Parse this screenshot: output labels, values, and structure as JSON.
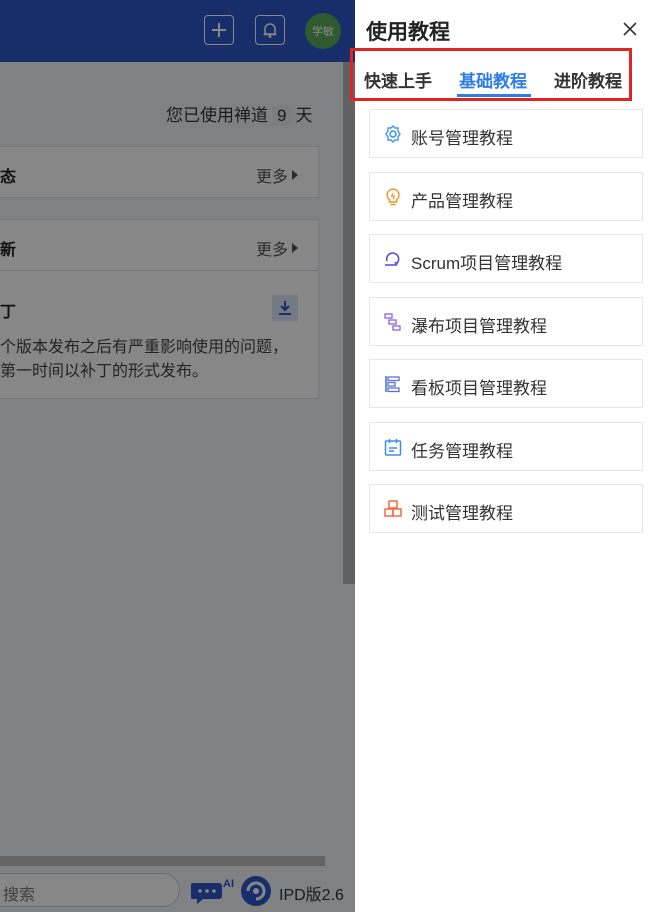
{
  "app": {
    "avatar_text": "学敏",
    "usage": {
      "prefix": "您已使用禅道",
      "days": "9",
      "suffix": "天"
    },
    "cards": {
      "dynamic": {
        "title": "态",
        "more": "更多"
      },
      "updates": {
        "title": "新",
        "more": "更多",
        "patch_title": "丁",
        "patch_lines": [
          "个版本发布之后有严重影响使用的问题，",
          "第一时间以补丁的形式发布。"
        ]
      }
    },
    "bottom": {
      "search_placeholder": "搜索",
      "ai_label": "AI",
      "version": "IPD版2.6"
    }
  },
  "drawer": {
    "title": "使用教程",
    "tabs": [
      {
        "label": "快速上手",
        "active": false
      },
      {
        "label": "基础教程",
        "active": true
      },
      {
        "label": "进阶教程",
        "active": false
      }
    ],
    "items": [
      {
        "label": "账号管理教程",
        "icon": "gear-icon",
        "color": "#3d9be9"
      },
      {
        "label": "产品管理教程",
        "icon": "lightbulb-icon",
        "color": "#f0922c"
      },
      {
        "label": "Scrum项目管理教程",
        "icon": "loop-icon",
        "color": "#5b4fd8"
      },
      {
        "label": "瀑布项目管理教程",
        "icon": "waterfall-icon",
        "color": "#8e6bf0"
      },
      {
        "label": "看板项目管理教程",
        "icon": "kanban-icon",
        "color": "#5b6fe0"
      },
      {
        "label": "任务管理教程",
        "icon": "calendar-icon",
        "color": "#3b8fe8"
      },
      {
        "label": "测试管理教程",
        "icon": "boxes-icon",
        "color": "#f06b40"
      }
    ]
  },
  "colors": {
    "accent": "#2f7ee6",
    "topbar": "#2c57c9",
    "highlight": "#e02424"
  }
}
